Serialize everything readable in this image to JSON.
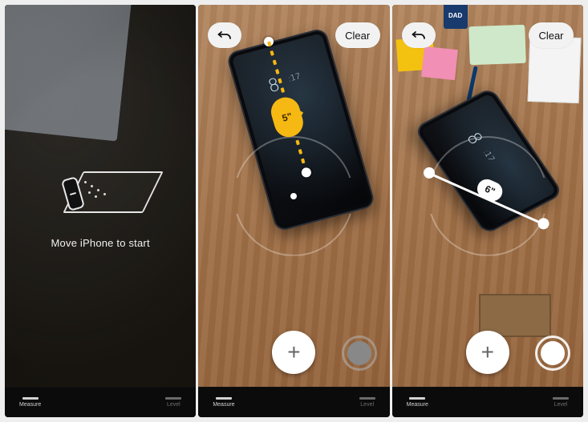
{
  "panel1": {
    "hint": "Move iPhone to start"
  },
  "panel2": {
    "undo_label": "Undo",
    "clear_label": "Clear",
    "measurement_label": "5\"",
    "phone_clock_hour": "8",
    "phone_clock_min": ":17"
  },
  "panel3": {
    "undo_label": "Undo",
    "clear_label": "Clear",
    "measurement_label": "6\"",
    "phone_clock_hour": "8",
    "phone_clock_min": ":17",
    "frame_text": "DAD"
  },
  "tabbar": {
    "measure": "Measure",
    "level": "Level"
  },
  "colors": {
    "accent_yellow": "#f6b813",
    "pill_bg": "#f2f2f2"
  }
}
